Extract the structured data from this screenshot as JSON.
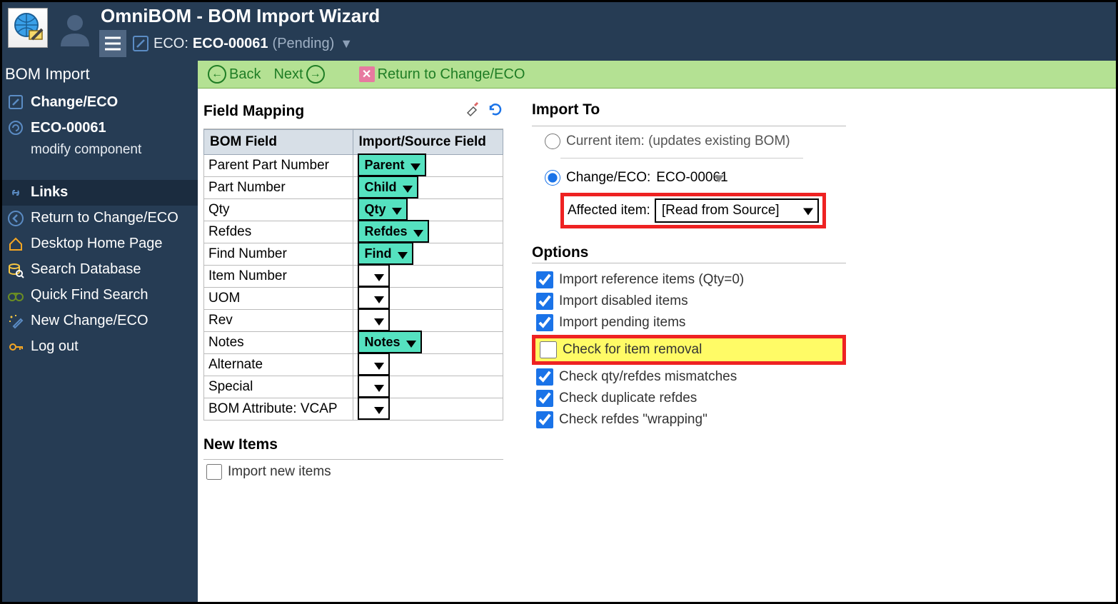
{
  "header": {
    "title": "OmniBOM - BOM Import Wizard",
    "eco_label": "ECO:",
    "eco_value": "ECO-00061",
    "eco_status": "(Pending)"
  },
  "sidebar": {
    "title": "BOM Import",
    "items": {
      "change": "Change/ECO",
      "eco": "ECO-00061",
      "eco_sub": "modify component",
      "links": "Links",
      "return": "Return to Change/ECO",
      "desktop": "Desktop Home Page",
      "search": "Search Database",
      "quick": "Quick Find Search",
      "newchange": "New Change/ECO",
      "logout": "Log out"
    }
  },
  "toolbar": {
    "back": "Back",
    "next": "Next",
    "return": "Return to Change/ECO"
  },
  "mapping": {
    "title": "Field Mapping",
    "col1": "BOM Field",
    "col2": "Import/Source Field",
    "rows": [
      {
        "f": "Parent Part Number",
        "v": "Parent",
        "filled": true
      },
      {
        "f": "Part Number",
        "v": "Child",
        "filled": true
      },
      {
        "f": "Qty",
        "v": "Qty",
        "filled": true
      },
      {
        "f": "Refdes",
        "v": "Refdes",
        "filled": true
      },
      {
        "f": "Find Number",
        "v": "Find",
        "filled": true
      },
      {
        "f": "Item Number",
        "v": "",
        "filled": false
      },
      {
        "f": "UOM",
        "v": "",
        "filled": false
      },
      {
        "f": "Rev",
        "v": "",
        "filled": false
      },
      {
        "f": "Notes",
        "v": "Notes",
        "filled": true
      },
      {
        "f": "Alternate",
        "v": "",
        "filled": false
      },
      {
        "f": "Special",
        "v": "",
        "filled": false
      },
      {
        "f": "BOM Attribute: VCAP",
        "v": "",
        "filled": false
      }
    ]
  },
  "newItems": {
    "title": "New Items",
    "import": "Import new items"
  },
  "importTo": {
    "title": "Import To",
    "current": "Current item: (updates existing BOM)",
    "change": "Change/ECO:",
    "change_value": "ECO-00061",
    "affected": "Affected item:",
    "affected_value": "[Read from Source]"
  },
  "options": {
    "title": "Options",
    "items": {
      "ref": "Import reference items (Qty=0)",
      "dis": "Import disabled items",
      "pend": "Import pending items",
      "removal": "Check for item removal",
      "qty": "Check qty/refdes mismatches",
      "dup": "Check duplicate refdes",
      "wrap": "Check refdes \"wrapping\""
    }
  }
}
